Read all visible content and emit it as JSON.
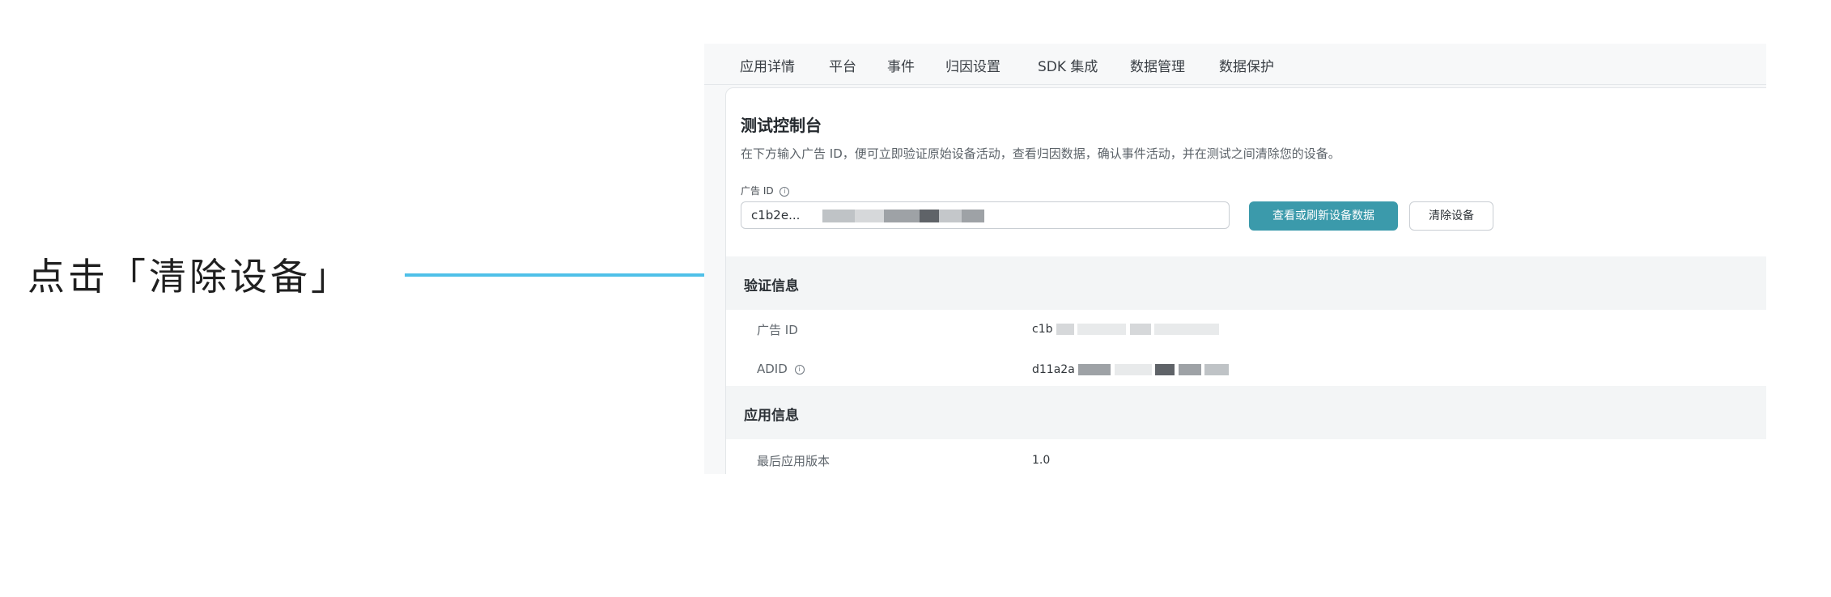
{
  "annotation": {
    "instruction": "点击「清除设备」",
    "arrow_color": "#4fc0e8"
  },
  "tabs": [
    "应用详情",
    "平台",
    "事件",
    "归因设置",
    "SDK 集成",
    "数据管理",
    "数据保护"
  ],
  "console": {
    "title": "测试控制台",
    "description": "在下方输入广告 ID，便可立即验证原始设备活动，查看归因数据，确认事件活动，并在测试之间清除您的设备。",
    "ad_id_label": "广告 ID",
    "ad_id_value": "c1b2e...",
    "view_button": "查看或刷新设备数据",
    "clear_button": "清除设备",
    "primary_color": "#3b9aab"
  },
  "verification": {
    "section_title": "验证信息",
    "rows": [
      {
        "key": "广告 ID",
        "value": "c1b"
      },
      {
        "key": "ADID",
        "value": "d11a2a"
      }
    ]
  },
  "app_info": {
    "section_title": "应用信息",
    "rows": [
      {
        "key": "最后应用版本",
        "value": "1.0"
      }
    ]
  }
}
